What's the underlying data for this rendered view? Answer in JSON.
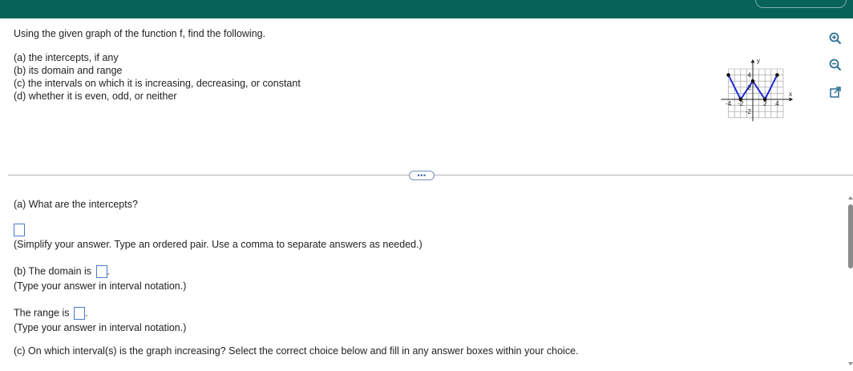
{
  "question": {
    "intro": "Using the given graph of the function f, find the following.",
    "parts": [
      "(a) the intercepts, if any",
      "(b) its domain and range",
      "(c) the intervals on which it is increasing, decreasing, or constant",
      "(d) whether it is even, odd, or neither"
    ]
  },
  "graph": {
    "x_axis_label": "x",
    "y_axis_label": "y",
    "x_tick_labels": [
      "-4",
      "-2",
      "2",
      "4"
    ],
    "y_tick_labels": [
      "4",
      "2",
      "-2"
    ],
    "points": [
      [
        -4,
        4
      ],
      [
        -2,
        0
      ],
      [
        0,
        3
      ],
      [
        2,
        0
      ],
      [
        4,
        4
      ]
    ],
    "colors": {
      "line": "#1f2bd6",
      "point": "#111111",
      "grid": "#9a9a9a"
    }
  },
  "tools": [
    "zoom-in-icon",
    "zoom-out-icon",
    "pop-out-icon"
  ],
  "more_button_label": "•••",
  "answers": {
    "a_question": "(a) What are the intercepts?",
    "a_hint": "(Simplify your answer. Type an ordered pair. Use a comma to separate answers as needed.)",
    "b_domain_label": "(b) The domain is",
    "b_domain_hint": "(Type your answer in interval notation.)",
    "range_label": "The range is",
    "range_hint": "(Type your answer in interval notation.)",
    "c_question": "(c) On which interval(s) is the graph increasing? Select the correct choice below and fill in any answer boxes within your choice."
  }
}
